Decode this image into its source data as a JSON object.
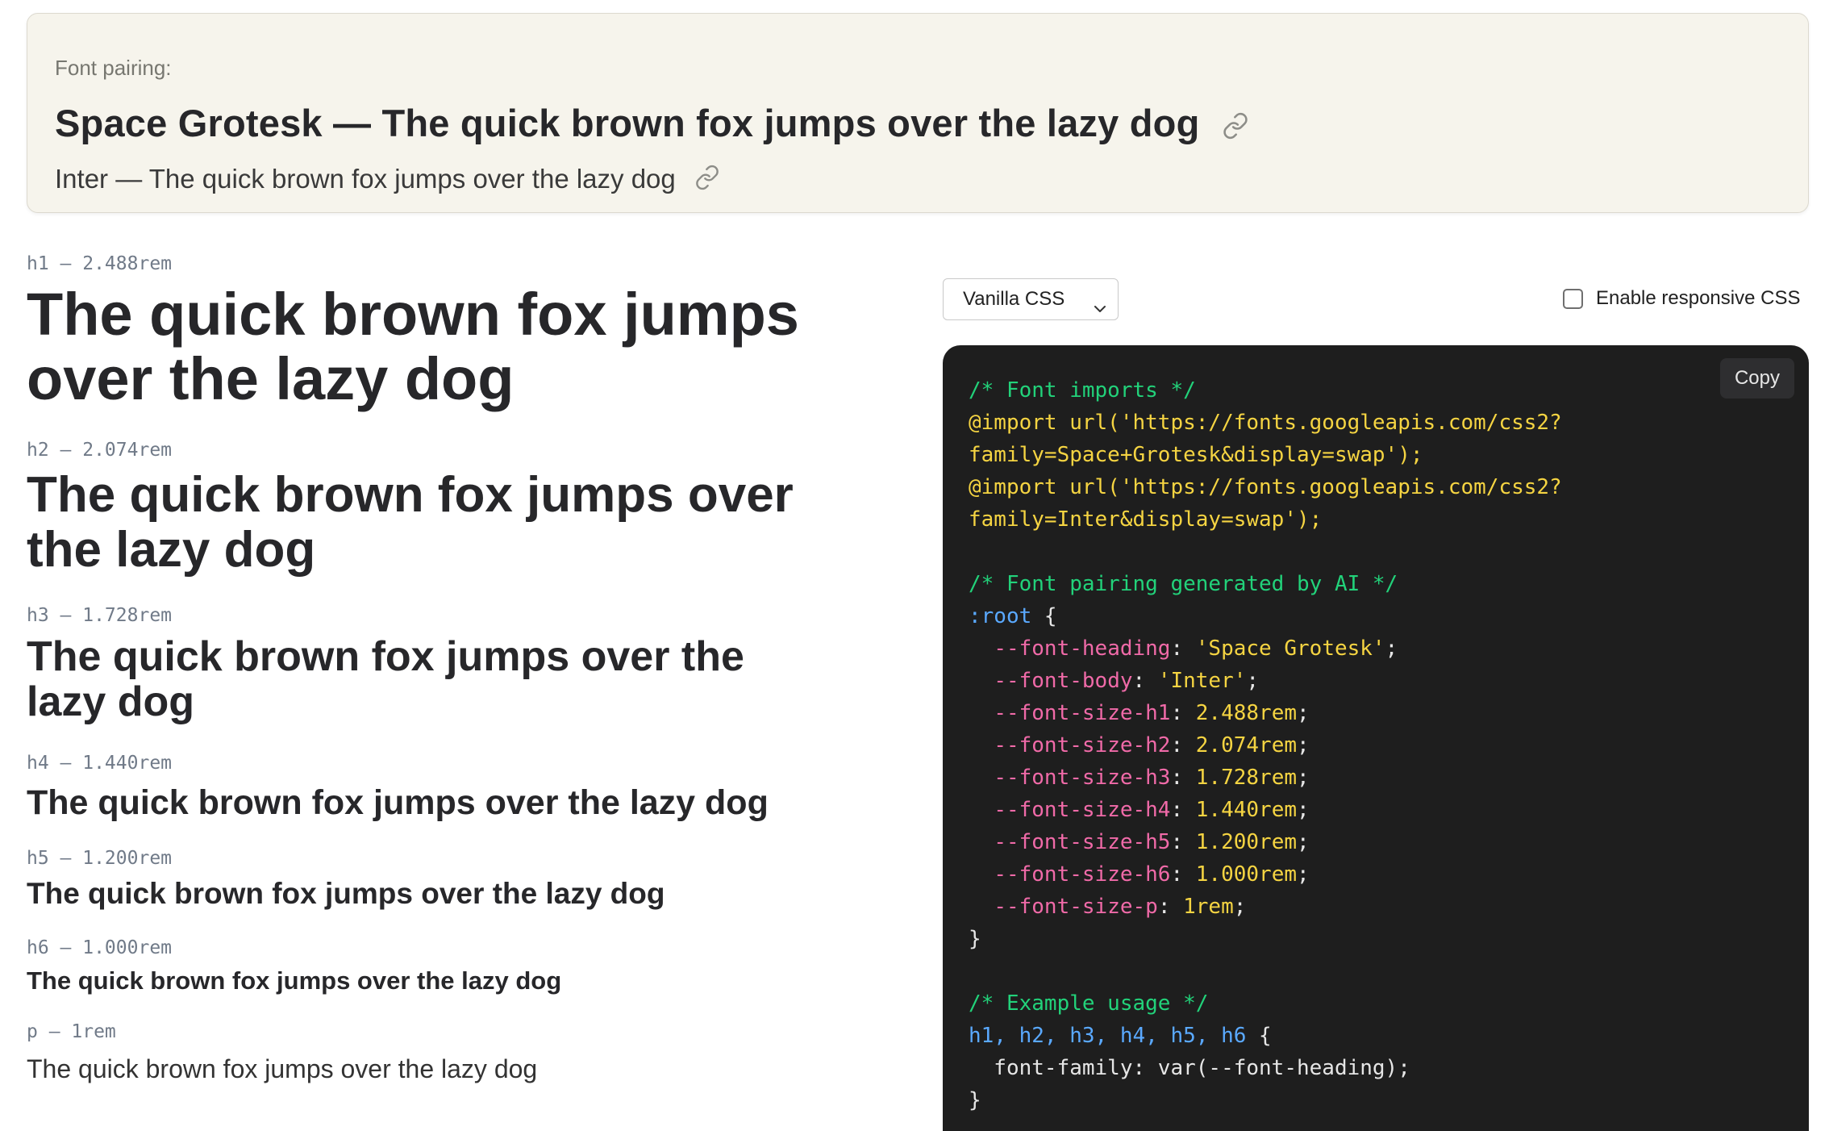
{
  "pairing": {
    "label": "Font pairing:",
    "heading_line": "Space Grotesk — The quick brown fox jumps over the lazy dog",
    "body_line": "Inter — The quick brown fox jumps over the lazy dog",
    "link_icon": "link-icon"
  },
  "scale": [
    {
      "label": "h1 – 2.488rem",
      "line1": "The quick brown fox jumps",
      "line2": "over the lazy dog"
    },
    {
      "label": "h2 – 2.074rem",
      "line1": "The quick brown fox jumps over",
      "line2": "the lazy dog"
    },
    {
      "label": "h3 – 1.728rem",
      "line1": "The quick brown fox jumps over the",
      "line2": "lazy dog"
    },
    {
      "label": "h4 – 1.440rem",
      "line1": "The quick brown fox jumps over the lazy dog"
    },
    {
      "label": "h5 – 1.200rem",
      "line1": "The quick brown fox jumps over the lazy dog"
    },
    {
      "label": "h6 – 1.000rem",
      "line1": "The quick brown fox jumps over the lazy dog"
    },
    {
      "label": "p – 1rem",
      "line1": "The quick brown fox jumps over the lazy dog"
    }
  ],
  "controls": {
    "format_select": "Vanilla CSS",
    "responsive_label": "Enable responsive CSS",
    "responsive_checked": false
  },
  "code": {
    "copy_label": "Copy",
    "lines": [
      [
        [
          "comment",
          "/* Font imports */"
        ]
      ],
      [
        [
          "import",
          "@import url('https://fonts.googleapis.com/css2?"
        ]
      ],
      [
        [
          "import",
          "family=Space+Grotesk&display=swap');"
        ]
      ],
      [
        [
          "import",
          "@import url('https://fonts.googleapis.com/css2?"
        ]
      ],
      [
        [
          "import",
          "family=Inter&display=swap');"
        ]
      ],
      [],
      [
        [
          "comment",
          "/* Font pairing generated by AI */"
        ]
      ],
      [
        [
          "selector",
          ":root"
        ],
        [
          "plain",
          " {"
        ]
      ],
      [
        [
          "plain",
          "  "
        ],
        [
          "prop",
          "--font-heading"
        ],
        [
          "plain",
          ": "
        ],
        [
          "val",
          "'Space Grotesk'"
        ],
        [
          "plain",
          ";"
        ]
      ],
      [
        [
          "plain",
          "  "
        ],
        [
          "prop",
          "--font-body"
        ],
        [
          "plain",
          ": "
        ],
        [
          "val",
          "'Inter'"
        ],
        [
          "plain",
          ";"
        ]
      ],
      [
        [
          "plain",
          "  "
        ],
        [
          "prop",
          "--font-size-h1"
        ],
        [
          "plain",
          ": "
        ],
        [
          "val",
          "2.488rem"
        ],
        [
          "plain",
          ";"
        ]
      ],
      [
        [
          "plain",
          "  "
        ],
        [
          "prop",
          "--font-size-h2"
        ],
        [
          "plain",
          ": "
        ],
        [
          "val",
          "2.074rem"
        ],
        [
          "plain",
          ";"
        ]
      ],
      [
        [
          "plain",
          "  "
        ],
        [
          "prop",
          "--font-size-h3"
        ],
        [
          "plain",
          ": "
        ],
        [
          "val",
          "1.728rem"
        ],
        [
          "plain",
          ";"
        ]
      ],
      [
        [
          "plain",
          "  "
        ],
        [
          "prop",
          "--font-size-h4"
        ],
        [
          "plain",
          ": "
        ],
        [
          "val",
          "1.440rem"
        ],
        [
          "plain",
          ";"
        ]
      ],
      [
        [
          "plain",
          "  "
        ],
        [
          "prop",
          "--font-size-h5"
        ],
        [
          "plain",
          ": "
        ],
        [
          "val",
          "1.200rem"
        ],
        [
          "plain",
          ";"
        ]
      ],
      [
        [
          "plain",
          "  "
        ],
        [
          "prop",
          "--font-size-h6"
        ],
        [
          "plain",
          ": "
        ],
        [
          "val",
          "1.000rem"
        ],
        [
          "plain",
          ";"
        ]
      ],
      [
        [
          "plain",
          "  "
        ],
        [
          "prop",
          "--font-size-p"
        ],
        [
          "plain",
          ": "
        ],
        [
          "val",
          "1rem"
        ],
        [
          "plain",
          ";"
        ]
      ],
      [
        [
          "plain",
          "}"
        ]
      ],
      [],
      [
        [
          "comment",
          "/* Example usage */"
        ]
      ],
      [
        [
          "selector",
          "h1, h2, h3, h4, h5, h6"
        ],
        [
          "plain",
          " {"
        ]
      ],
      [
        [
          "plain",
          "  font-family: var(--font-heading);"
        ]
      ],
      [
        [
          "plain",
          "}"
        ]
      ]
    ]
  }
}
